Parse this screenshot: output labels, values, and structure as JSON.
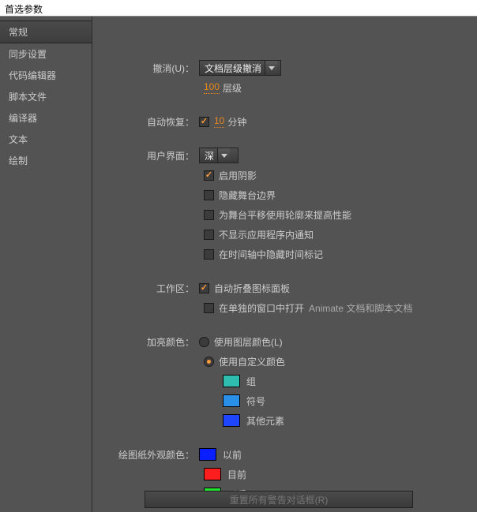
{
  "window": {
    "title": "首选参数"
  },
  "sidebar": {
    "items": [
      {
        "label": "常规"
      },
      {
        "label": "同步设置"
      },
      {
        "label": "代码编辑器"
      },
      {
        "label": "脚本文件"
      },
      {
        "label": "编译器"
      },
      {
        "label": "文本"
      },
      {
        "label": "绘制"
      }
    ]
  },
  "undo": {
    "label": "撤消(U)：",
    "dropdown": "文档层级撤消",
    "levels_num": "100",
    "levels_unit": "层级"
  },
  "autoRecover": {
    "label": "自动恢复：",
    "minutes_num": "10",
    "minutes_unit": "分钟"
  },
  "ui": {
    "label": "用户界面：",
    "dropdown": "深",
    "opts": {
      "shadow": "启用阴影",
      "hideStage": "隐藏舞台边界",
      "panPerf": "为舞台平移使用轮廓来提高性能",
      "noNotify": "不显示应用程序内通知",
      "hideTime": "在时间轴中隐藏时间标记"
    }
  },
  "workspace": {
    "label": "工作区：",
    "autoCollapse": "自动折叠图标面板",
    "openSeparate_a": "在单独的窗口中打开",
    "openSeparate_b": "Animate 文档和脚本文档"
  },
  "highlight": {
    "label": "加亮颜色：",
    "useLayer": "使用图层颜色(L)",
    "useCustom": "使用自定义颜色",
    "group": {
      "label": "组",
      "color": "#2fbdb0"
    },
    "symbol": {
      "label": "符号",
      "color": "#2a8fe6"
    },
    "other": {
      "label": "其他元素",
      "color": "#1f46ff"
    }
  },
  "onion": {
    "label": "绘图纸外观颜色：",
    "before": {
      "label": "以前",
      "color": "#0a1fff"
    },
    "current": {
      "label": "目前",
      "color": "#ff1e1e"
    },
    "after": {
      "label": "以后",
      "color": "#20e52e"
    }
  },
  "reset": {
    "label": "重置所有警告对话框(R)"
  }
}
